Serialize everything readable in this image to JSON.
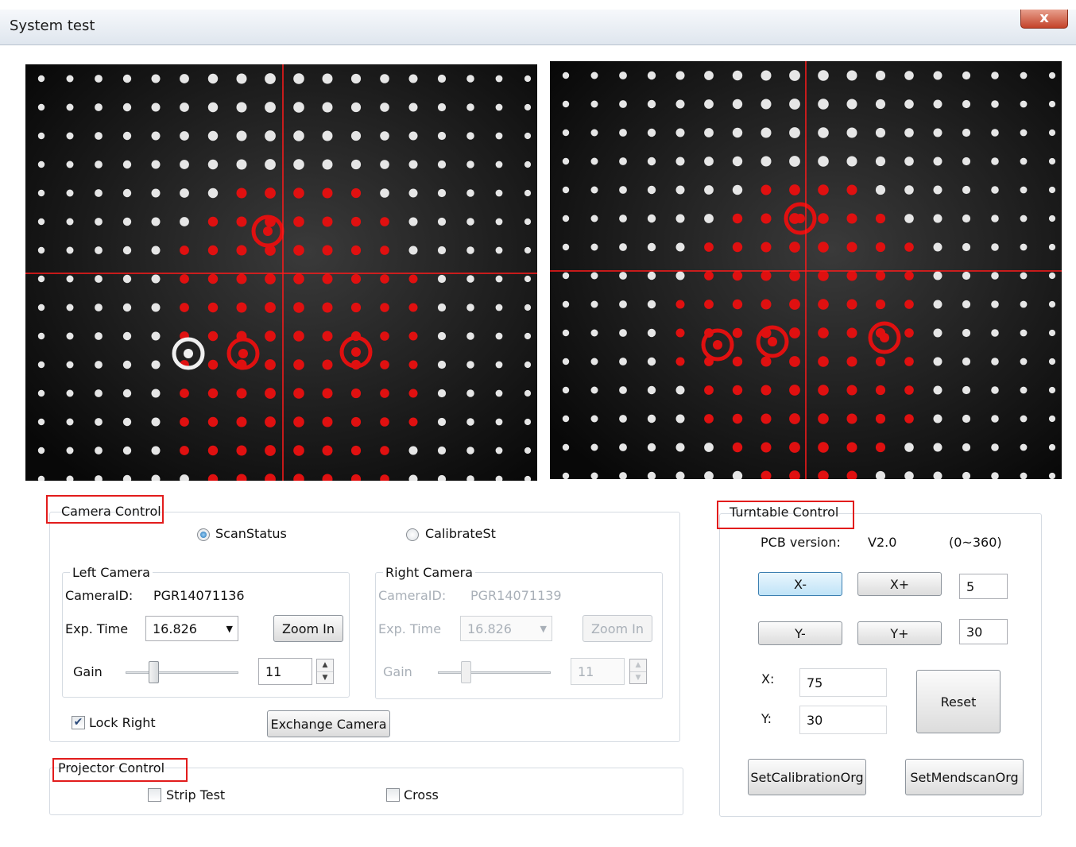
{
  "window": {
    "title": "System test",
    "close_label": "x"
  },
  "camera_control": {
    "label": "Camera Control",
    "modes": [
      {
        "label": "ScanStatus",
        "selected": true
      },
      {
        "label": "CalibrateSt",
        "selected": false
      }
    ],
    "left_camera": {
      "label": "Left Camera",
      "camera_id_label": "CameraID:",
      "camera_id": "PGR14071136",
      "exp_time_label": "Exp. Time",
      "exp_time": "16.826",
      "zoom_label": "Zoom In",
      "gain_label": "Gain",
      "gain_value": "11",
      "gain_level": 0.25
    },
    "right_camera": {
      "label": "Right Camera",
      "camera_id_label": "CameraID:",
      "camera_id": "PGR14071139",
      "exp_time_label": "Exp. Time",
      "exp_time": "16.826",
      "zoom_label": "Zoom In",
      "gain_label": "Gain",
      "gain_value": "11",
      "gain_level": 0.25
    },
    "lock_right_label": "Lock Right",
    "lock_right_checked": true,
    "exchange_label": "Exchange Camera"
  },
  "projector_control": {
    "label": "Projector Control",
    "strip_test_label": "Strip Test",
    "cross_label": "Cross"
  },
  "turntable_control": {
    "label": "Turntable Control",
    "pcb_label": "PCB version:",
    "pcb_value": "V2.0",
    "range_label": "(0~360)",
    "x_minus": "X-",
    "x_plus": "X+",
    "x_step": "5",
    "y_minus": "Y-",
    "y_plus": "Y+",
    "y_step": "30",
    "x_label": "X:",
    "x_value": "75",
    "y_label": "Y:",
    "y_value": "30",
    "reset_label": "Reset",
    "set_calibration_label": "SetCalibrationOrg",
    "set_mendscan_label": "SetMendscanOrg"
  },
  "colors": {
    "accent_red": "#e21c1c",
    "crosshair": "#ff1a1a",
    "dot": "#e8e8e8"
  }
}
